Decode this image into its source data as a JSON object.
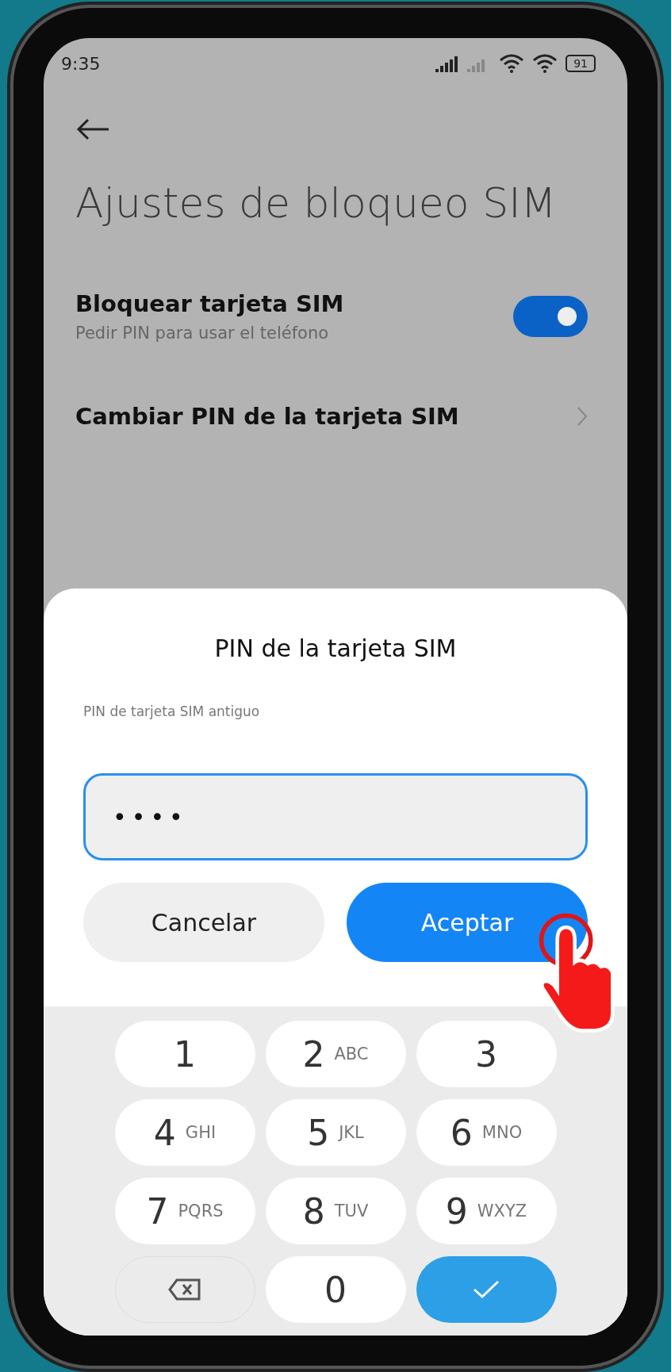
{
  "status_bar": {
    "time": "9:35",
    "battery": "91"
  },
  "title": "Ajustes de bloqueo SIM",
  "settings": [
    {
      "kind": "toggle",
      "title": "Bloquear tarjeta SIM",
      "subtitle": "Pedir PIN para usar el teléfono",
      "on": true
    },
    {
      "kind": "link",
      "title": "Cambiar PIN de la tarjeta SIM"
    }
  ],
  "dialog": {
    "title": "PIN de la tarjeta SIM",
    "label": "PIN de tarjeta SIM antiguo",
    "value": "••••",
    "buttons": [
      {
        "label": "Cancelar",
        "primary": false
      },
      {
        "label": "Aceptar",
        "primary": true
      }
    ]
  },
  "keypad": [
    {
      "kind": "digit",
      "digit": "1"
    },
    {
      "kind": "digit",
      "digit": "2",
      "letters": "ABC"
    },
    {
      "kind": "digit",
      "digit": "3"
    },
    {
      "kind": "digit",
      "digit": "4",
      "letters": "GHI"
    },
    {
      "kind": "digit",
      "digit": "5",
      "letters": "JKL"
    },
    {
      "kind": "digit",
      "digit": "6",
      "letters": "MNO"
    },
    {
      "kind": "digit",
      "digit": "7",
      "letters": "PQRS"
    },
    {
      "kind": "digit",
      "digit": "8",
      "letters": "TUV"
    },
    {
      "kind": "digit",
      "digit": "9",
      "letters": "WXYZ"
    },
    {
      "kind": "backspace"
    },
    {
      "kind": "digit",
      "digit": "0"
    },
    {
      "kind": "enter"
    }
  ]
}
